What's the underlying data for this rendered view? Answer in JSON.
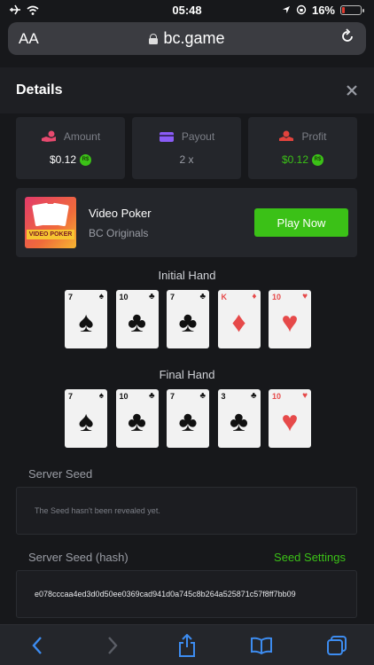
{
  "status_bar": {
    "time": "05:48",
    "battery": "16%"
  },
  "url_bar": {
    "aa": "AA",
    "domain": "bc.game"
  },
  "modal": {
    "title": "Details"
  },
  "stats": {
    "amount": {
      "label": "Amount",
      "value": "$0.12"
    },
    "payout": {
      "label": "Payout",
      "value": "2 x"
    },
    "profit": {
      "label": "Profit",
      "value": "$0.12"
    },
    "coin_symbol": "R$"
  },
  "game": {
    "name": "Video Poker",
    "provider": "BC Originals",
    "thumb_label": "VIDEO POKER",
    "play_label": "Play Now"
  },
  "initial_hand": {
    "title": "Initial Hand",
    "cards": [
      {
        "rank": "7",
        "suit": "♠",
        "color": "black"
      },
      {
        "rank": "10",
        "suit": "♣",
        "color": "black"
      },
      {
        "rank": "7",
        "suit": "♣",
        "color": "black"
      },
      {
        "rank": "K",
        "suit": "♦",
        "color": "red"
      },
      {
        "rank": "10",
        "suit": "♥",
        "color": "red"
      }
    ]
  },
  "final_hand": {
    "title": "Final Hand",
    "cards": [
      {
        "rank": "7",
        "suit": "♠",
        "color": "black"
      },
      {
        "rank": "10",
        "suit": "♣",
        "color": "black"
      },
      {
        "rank": "7",
        "suit": "♣",
        "color": "black"
      },
      {
        "rank": "3",
        "suit": "♣",
        "color": "black"
      },
      {
        "rank": "10",
        "suit": "♥",
        "color": "red"
      }
    ]
  },
  "server_seed": {
    "label": "Server Seed",
    "value": "The Seed hasn't been revealed yet."
  },
  "server_seed_hash": {
    "label": "Server Seed (hash)",
    "settings_label": "Seed Settings",
    "value": "e078cccaa4ed3d0d50ee0369cad941d0a745c8b264a525871c57f8ff7bb09"
  },
  "colors": {
    "accent_green": "#3bc117",
    "background": "#17181b",
    "panel": "#24262b",
    "amount_icon": "#e84a6f",
    "payout_icon": "#8a5cf6",
    "profit_icon": "#e2433d"
  },
  "icons": {
    "amount": "hand-coin-icon",
    "payout": "card-icon",
    "profit": "profit-icon"
  }
}
